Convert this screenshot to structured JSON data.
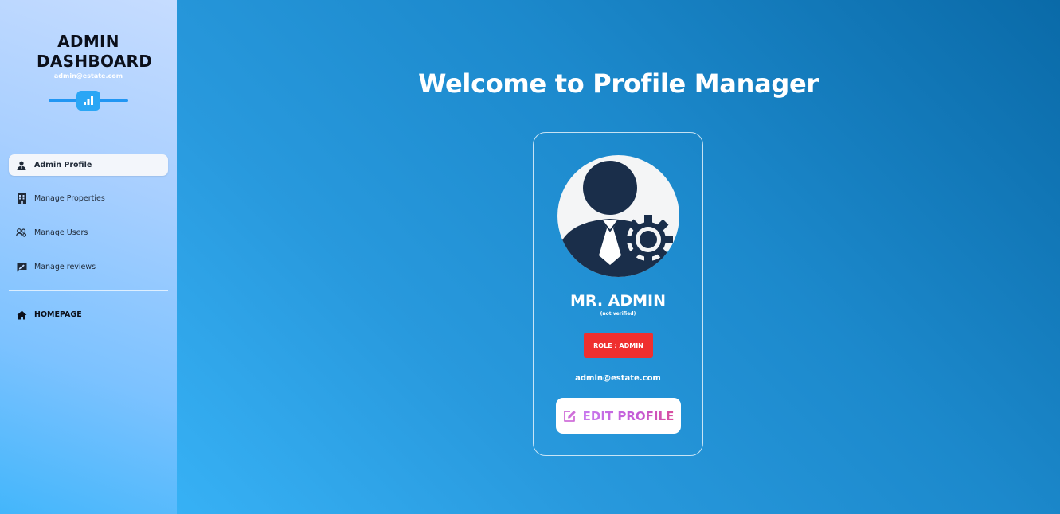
{
  "sidebar": {
    "brand": {
      "title": "ADMIN DASHBOARD",
      "email": "admin@estate.com",
      "icon": "chart-icon"
    },
    "items": [
      {
        "label": "Admin Profile",
        "icon": "user-tie-icon",
        "active": true
      },
      {
        "label": "Manage Properties",
        "icon": "building-icon",
        "active": false
      },
      {
        "label": "Manage Users",
        "icon": "users-gear-icon",
        "active": false
      },
      {
        "label": "Manage reviews",
        "icon": "review-icon",
        "active": false
      }
    ],
    "home": {
      "label": "HOMEPAGE",
      "icon": "home-icon"
    }
  },
  "main": {
    "title": "Welcome to Profile Manager",
    "profile": {
      "name": "MR. ADMIN",
      "status": "(not verified)",
      "role": "ROLE : ADMIN",
      "email": "admin@estate.com",
      "edit_label": "EDIT PROFILE",
      "edit_icon": "edit-icon"
    }
  },
  "colors": {
    "role_badge": "#ef2f2f",
    "avatar_figure": "#1a2e4a",
    "edit_gradient": [
      "#c879ef",
      "#d94d9e"
    ]
  }
}
